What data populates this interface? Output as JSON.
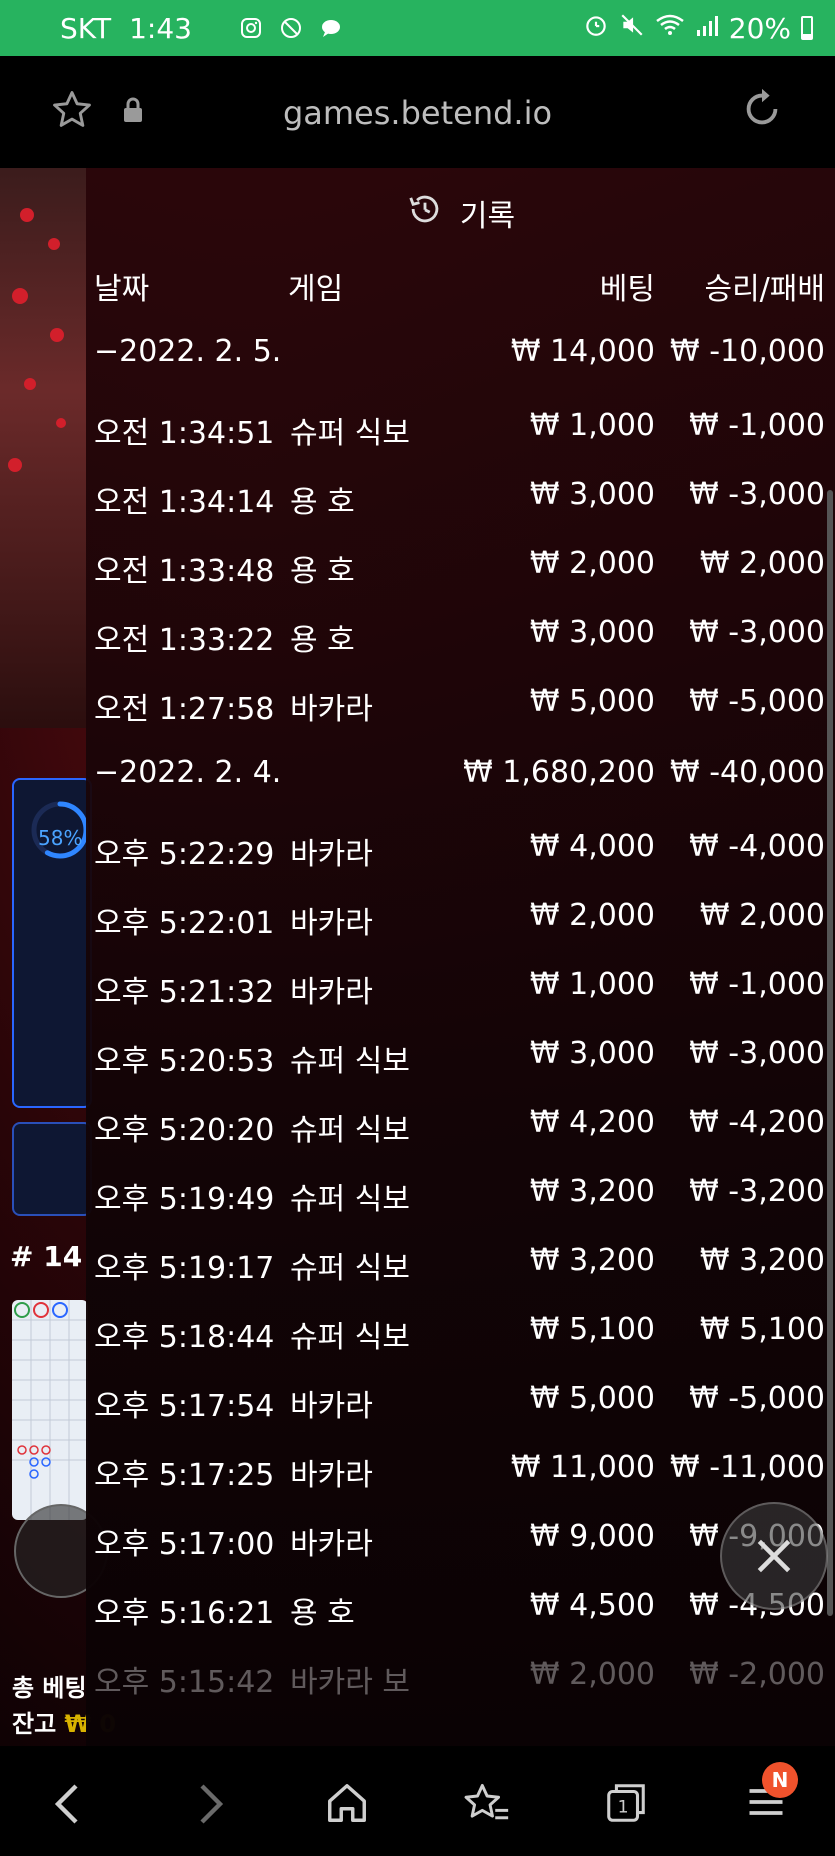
{
  "status_bar": {
    "carrier": "SKT",
    "time": "1:43",
    "battery": "20%",
    "battery_level": 0.2
  },
  "browser": {
    "url": "games.betend.io"
  },
  "background_game": {
    "progress": "58%",
    "progress_value": 0.58,
    "round_label": "# 14",
    "total_bet_label": "총 베팅",
    "balance_label": "잔고",
    "balance_value": "₩ 0"
  },
  "history": {
    "title": "기록",
    "columns": {
      "date": "날짜",
      "game": "게임",
      "bet": "베팅",
      "win_loss": "승리/패배"
    },
    "groups": [
      {
        "date": "−2022. 2. 5.",
        "bet": "₩ 14,000",
        "win_loss": "₩ -10,000",
        "rows": [
          {
            "time": "오전 1:34:51",
            "game": "슈퍼 식보",
            "bet": "₩ 1,000",
            "win_loss": "₩ -1,000"
          },
          {
            "time": "오전 1:34:14",
            "game": "용 호",
            "bet": "₩ 3,000",
            "win_loss": "₩ -3,000"
          },
          {
            "time": "오전 1:33:48",
            "game": "용 호",
            "bet": "₩ 2,000",
            "win_loss": "₩ 2,000"
          },
          {
            "time": "오전 1:33:22",
            "game": "용 호",
            "bet": "₩ 3,000",
            "win_loss": "₩ -3,000"
          },
          {
            "time": "오전 1:27:58",
            "game": "바카라",
            "bet": "₩ 5,000",
            "win_loss": "₩ -5,000"
          }
        ]
      },
      {
        "date": "−2022. 2. 4.",
        "bet": "₩ 1,680,200",
        "win_loss": "₩ -40,000",
        "rows": [
          {
            "time": "오후 5:22:29",
            "game": "바카라",
            "bet": "₩ 4,000",
            "win_loss": "₩ -4,000"
          },
          {
            "time": "오후 5:22:01",
            "game": "바카라",
            "bet": "₩ 2,000",
            "win_loss": "₩ 2,000"
          },
          {
            "time": "오후 5:21:32",
            "game": "바카라",
            "bet": "₩ 1,000",
            "win_loss": "₩ -1,000"
          },
          {
            "time": "오후 5:20:53",
            "game": "슈퍼 식보",
            "bet": "₩ 3,000",
            "win_loss": "₩ -3,000"
          },
          {
            "time": "오후 5:20:20",
            "game": "슈퍼 식보",
            "bet": "₩ 4,200",
            "win_loss": "₩ -4,200"
          },
          {
            "time": "오후 5:19:49",
            "game": "슈퍼 식보",
            "bet": "₩ 3,200",
            "win_loss": "₩ -3,200"
          },
          {
            "time": "오후 5:19:17",
            "game": "슈퍼 식보",
            "bet": "₩ 3,200",
            "win_loss": "₩ 3,200"
          },
          {
            "time": "오후 5:18:44",
            "game": "슈퍼 식보",
            "bet": "₩ 5,100",
            "win_loss": "₩ 5,100"
          },
          {
            "time": "오후 5:17:54",
            "game": "바카라",
            "bet": "₩ 5,000",
            "win_loss": "₩ -5,000"
          },
          {
            "time": "오후 5:17:25",
            "game": "바카라",
            "bet": "₩ 11,000",
            "win_loss": "₩ -11,000"
          },
          {
            "time": "오후 5:17:00",
            "game": "바카라",
            "bet": "₩ 9,000",
            "win_loss": "₩ -9,000"
          },
          {
            "time": "오후 5:16:21",
            "game": "용 호",
            "bet": "₩ 4,500",
            "win_loss": "₩ -4,500"
          },
          {
            "time": "오후 5:15:42",
            "game": "바카라 보",
            "bet": "₩ 2,000",
            "win_loss": "₩ -2,000"
          }
        ]
      }
    ]
  },
  "bottom_nav": {
    "tab_count": "1",
    "menu_badge": "N"
  },
  "colors": {
    "status_bar": "#27b35f",
    "accent_blue": "#2a66ff",
    "badge": "#f0522c"
  }
}
